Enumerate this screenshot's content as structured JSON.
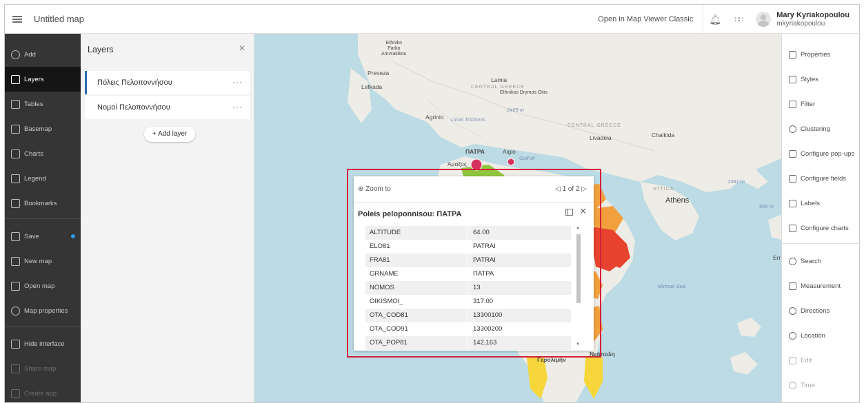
{
  "header": {
    "title": "Untitled map",
    "open_classic": "Open in Map Viewer Classic",
    "user_name": "Mary Kyriakopoulou",
    "user_id": "mkyriakopoulou"
  },
  "leftbar": {
    "items": [
      {
        "label": "Add",
        "icon": "plus-circle-icon"
      },
      {
        "label": "Layers",
        "icon": "layers-icon"
      },
      {
        "label": "Tables",
        "icon": "table-icon"
      },
      {
        "label": "Basemap",
        "icon": "basemap-icon"
      },
      {
        "label": "Charts",
        "icon": "chart-icon"
      },
      {
        "label": "Legend",
        "icon": "legend-icon"
      },
      {
        "label": "Bookmarks",
        "icon": "bookmark-icon"
      },
      {
        "label": "Save",
        "icon": "save-icon"
      },
      {
        "label": "New map",
        "icon": "new-map-icon"
      },
      {
        "label": "Open map",
        "icon": "folder-icon"
      },
      {
        "label": "Map properties",
        "icon": "gear-icon"
      },
      {
        "label": "Hide interface",
        "icon": "monitor-icon"
      },
      {
        "label": "Share map",
        "icon": "share-icon"
      },
      {
        "label": "Create app",
        "icon": "apps-icon"
      }
    ]
  },
  "layers_panel": {
    "title": "Layers",
    "rows": [
      "Πόλεις Πελοποννήσου",
      "Νομοί Πελοποννήσου"
    ],
    "add_label": "+ Add layer"
  },
  "map_labels": {
    "epiro": "Ethniko\nParko\nAmvrakikou",
    "preveza": "Preveza",
    "lefkada": "Lefkada",
    "lamia": "Lamia",
    "central_greece": "CENTRAL GREECE",
    "ethnikos_drymos": "Ethnikos Drymos Oitis",
    "elev_2469": "2469 m",
    "agrinio": "Agrinio",
    "limni": "Limni Trichonis",
    "central2": "CENTRAL GREECE",
    "livadeia": "Livadeia",
    "chalkida": "Chalkida",
    "patra": "ΠΑΤΡΑ",
    "aigio": "Aigio",
    "gulf": "Gulf of",
    "argos_patras": "Άραξος",
    "athens": "Athens",
    "attica": "ATTICA",
    "elev_1381": "1381 m",
    "elev_995": "995 m",
    "mirtoan": "Mirtoan Sea",
    "err": "Err",
    "geroliminas": "Γερολιμήν",
    "neapoli": "Νεάπολη"
  },
  "popup": {
    "zoom_to": "Zoom to",
    "pager": "1 of 2",
    "title": "Poleis peloponnisou: ΠΑΤΡΑ",
    "rows": [
      {
        "k": "ALTITUDE",
        "v": "64.00"
      },
      {
        "k": "ELO81",
        "v": "PATRAI"
      },
      {
        "k": "FRA81",
        "v": "PATRAI"
      },
      {
        "k": "GRNAME",
        "v": "ΠΑΤΡΑ"
      },
      {
        "k": "NOMOS",
        "v": "13"
      },
      {
        "k": "OIKISMOI_",
        "v": "317.00"
      },
      {
        "k": "OTA_COD81",
        "v": "13300100"
      },
      {
        "k": "OTA_COD91",
        "v": "13300200"
      },
      {
        "k": "OTA_POP81",
        "v": "142,163"
      }
    ]
  },
  "rightbar": {
    "items": [
      {
        "label": "Properties",
        "icon": "properties-icon"
      },
      {
        "label": "Styles",
        "icon": "styles-icon"
      },
      {
        "label": "Filter",
        "icon": "filter-icon"
      },
      {
        "label": "Clustering",
        "icon": "clustering-icon"
      },
      {
        "label": "Configure pop-ups",
        "icon": "popup-icon"
      },
      {
        "label": "Configure fields",
        "icon": "fields-icon"
      },
      {
        "label": "Labels",
        "icon": "label-icon"
      },
      {
        "label": "Configure charts",
        "icon": "chart-icon"
      },
      {
        "label": "Search",
        "icon": "search-icon"
      },
      {
        "label": "Measurement",
        "icon": "measure-icon"
      },
      {
        "label": "Directions",
        "icon": "directions-icon"
      },
      {
        "label": "Location",
        "icon": "location-icon"
      },
      {
        "label": "Edit",
        "icon": "edit-icon"
      },
      {
        "label": "Time",
        "icon": "clock-icon"
      }
    ]
  }
}
